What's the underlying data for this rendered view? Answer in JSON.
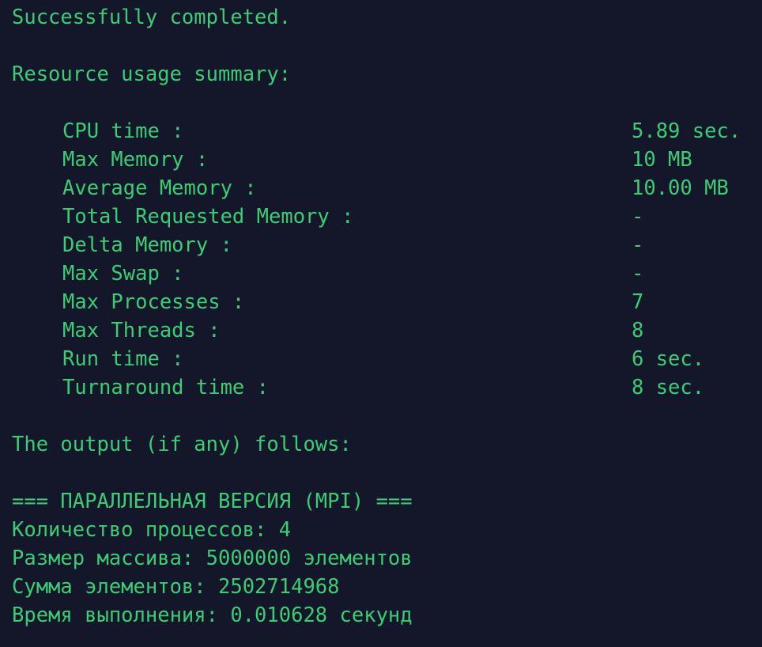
{
  "terminal": {
    "status_line": "Successfully completed.",
    "summary_heading": "Resource usage summary:",
    "resources": [
      {
        "label": "CPU time :",
        "value": "5.89 sec."
      },
      {
        "label": "Max Memory :",
        "value": "10 MB"
      },
      {
        "label": "Average Memory :",
        "value": "10.00 MB"
      },
      {
        "label": "Total Requested Memory :",
        "value": "-"
      },
      {
        "label": "Delta Memory :",
        "value": "-"
      },
      {
        "label": "Max Swap :",
        "value": "-"
      },
      {
        "label": "Max Processes :",
        "value": "7"
      },
      {
        "label": "Max Threads :",
        "value": "8"
      },
      {
        "label": "Run time :",
        "value": "6 sec."
      },
      {
        "label": "Turnaround time :",
        "value": "8 sec."
      }
    ],
    "output_heading": "The output (if any) follows:",
    "program_output": [
      "=== ПАРАЛЛЕЛЬНАЯ ВЕРСИЯ (MPI) ===",
      "Количество процессов: 4",
      "Размер массива: 5000000 элементов",
      "Сумма элементов: 2502714968",
      "Время выполнения: 0.010628 секунд"
    ],
    "colors": {
      "background": "#14172a",
      "text": "#3ccd74"
    }
  }
}
